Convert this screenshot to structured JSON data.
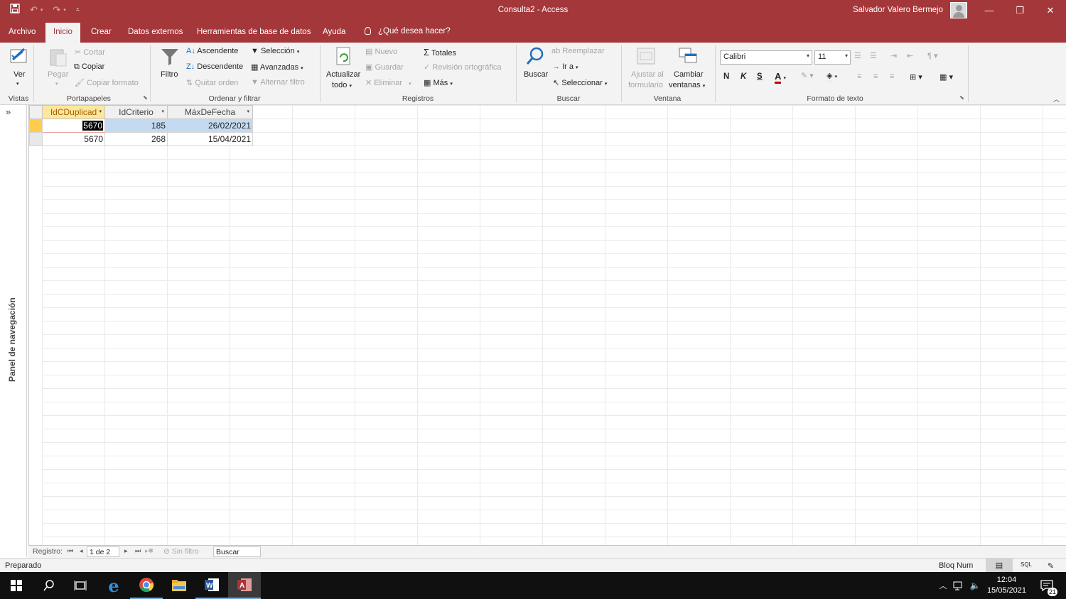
{
  "window": {
    "title": "Consulta2  -  Access",
    "user": "Salvador Valero Bermejo"
  },
  "tabs": [
    "Archivo",
    "Inicio",
    "Crear",
    "Datos externos",
    "Herramientas de base de datos",
    "Ayuda"
  ],
  "tell_me": "¿Qué desea hacer?",
  "ribbon": {
    "vistas": {
      "ver": "Ver",
      "group": "Vistas"
    },
    "portapapeles": {
      "pegar": "Pegar",
      "cortar": "Cortar",
      "copiar": "Copiar",
      "copiar_formato": "Copiar formato",
      "group": "Portapapeles"
    },
    "ordenar": {
      "filtro": "Filtro",
      "ascendente": "Ascendente",
      "descendente": "Descendente",
      "quitar_orden": "Quitar orden",
      "seleccion": "Selección",
      "avanzadas": "Avanzadas",
      "alternar_filtro": "Alternar filtro",
      "group": "Ordenar y filtrar"
    },
    "registros": {
      "actualizar": "Actualizar",
      "todo": "todo",
      "nuevo": "Nuevo",
      "guardar": "Guardar",
      "eliminar": "Eliminar",
      "totales": "Totales",
      "revision": "Revisión ortográfica",
      "mas": "Más",
      "group": "Registros"
    },
    "buscar": {
      "buscar": "Buscar",
      "reemplazar": "Reemplazar",
      "ir_a": "Ir a",
      "seleccionar": "Seleccionar",
      "group": "Buscar"
    },
    "ventana": {
      "ajustar1": "Ajustar al",
      "ajustar2": "formulario",
      "cambiar1": "Cambiar",
      "cambiar2": "ventanas",
      "group": "Ventana"
    },
    "formato": {
      "font": "Calibri",
      "size": "11",
      "bold": "N",
      "italic": "K",
      "underline": "S",
      "group": "Formato de texto",
      "font_color": "#c00000"
    }
  },
  "nav_pane": {
    "label": "Panel de navegación"
  },
  "datasheet": {
    "columns": [
      "IdCDuplicad",
      "IdCriterio",
      "MáxDeFecha"
    ],
    "rows": [
      [
        "5670",
        "185",
        "26/02/2021"
      ],
      [
        "5670",
        "268",
        "15/04/2021"
      ]
    ]
  },
  "record_nav": {
    "label": "Registro:",
    "position": "1 de 2",
    "filter": "Sin filtro",
    "search": "Buscar"
  },
  "status": {
    "left": "Preparado",
    "bloq": "Bloq Num",
    "sql": "SQL"
  },
  "taskbar": {
    "time": "12:04",
    "date": "15/05/2021",
    "notif": "21"
  },
  "colors": {
    "accent": "#a4373a",
    "selected_header": "#fce79c",
    "selected_row": "#c4daf0"
  }
}
